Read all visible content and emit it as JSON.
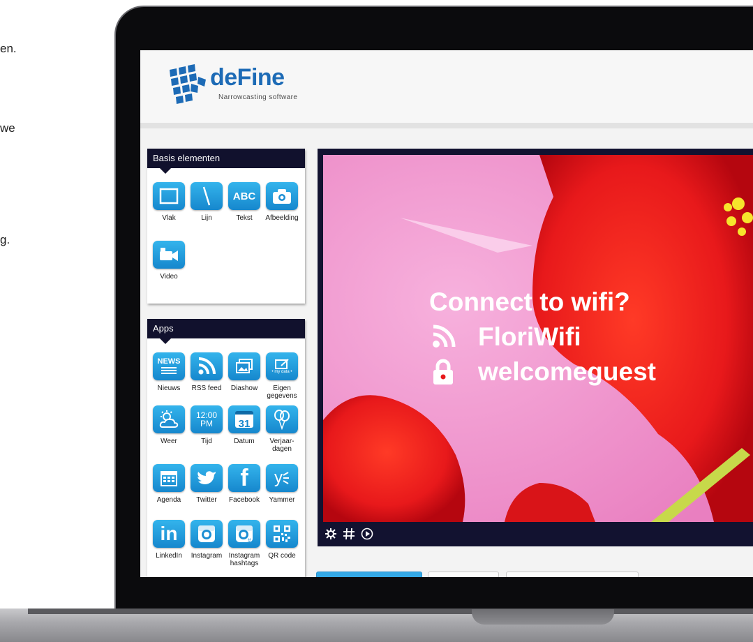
{
  "side_fragments": [
    "en.",
    "we",
    "g."
  ],
  "app": {
    "logo_name": "deFine",
    "logo_tagline": "Narrowcasting software"
  },
  "basis_panel": {
    "title": "Basis elementen",
    "items": [
      {
        "label": "Vlak",
        "icon": "square-icon"
      },
      {
        "label": "Lijn",
        "icon": "line-icon"
      },
      {
        "label": "Tekst",
        "icon": "text-icon",
        "icon_text": "ABC"
      },
      {
        "label": "Afbeelding",
        "icon": "camera-icon"
      },
      {
        "label": "Video",
        "icon": "video-camera-icon"
      }
    ]
  },
  "apps_panel": {
    "title": "Apps",
    "items": [
      {
        "label": "Nieuws",
        "icon": "news-icon",
        "icon_text": "NEWS"
      },
      {
        "label": "RSS feed",
        "icon": "rss-icon"
      },
      {
        "label": "Diashow",
        "icon": "slideshow-icon"
      },
      {
        "label": "Eigen gegevens",
        "icon": "my-data-icon",
        "icon_text": "• my data •"
      },
      {
        "label": "Weer",
        "icon": "weather-icon"
      },
      {
        "label": "Tijd",
        "icon": "clock-icon",
        "icon_text": "12:00 PM"
      },
      {
        "label": "Datum",
        "icon": "calendar-date-icon",
        "icon_text": "31"
      },
      {
        "label": "Verjaar-dagen",
        "icon": "balloons-icon"
      },
      {
        "label": "Agenda",
        "icon": "agenda-icon"
      },
      {
        "label": "Twitter",
        "icon": "twitter-icon"
      },
      {
        "label": "Facebook",
        "icon": "facebook-icon",
        "icon_text": "f"
      },
      {
        "label": "Yammer",
        "icon": "yammer-icon",
        "icon_text": "y"
      },
      {
        "label": "LinkedIn",
        "icon": "linkedin-icon",
        "icon_text": "in"
      },
      {
        "label": "Instagram",
        "icon": "instagram-icon"
      },
      {
        "label": "Instagram hashtags",
        "icon": "instagram-hashtag-icon"
      },
      {
        "label": "QR code",
        "icon": "qr-code-icon"
      }
    ]
  },
  "preview": {
    "heading": "Connect to wifi?",
    "network": "FloriWifi",
    "password": "welcomeguest",
    "toolbar_icons": [
      "gear-icon",
      "grid-hash-icon",
      "play-icon"
    ]
  },
  "colors": {
    "brand_blue": "#1d6bb6",
    "tile_blue": "#1f9ee0",
    "panel_navy": "#11112d",
    "photo_pink": "#ef8ec8",
    "flower_red": "#e8191b"
  }
}
